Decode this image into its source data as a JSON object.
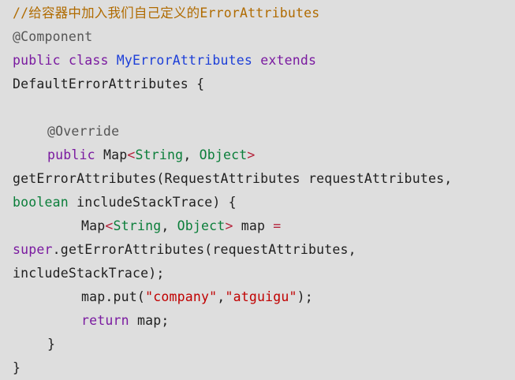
{
  "code": {
    "line1": {
      "comment_prefix": "//给容器中加入我们自己定义的",
      "comment_suffix": "ErrorAttributes"
    },
    "line2": {
      "annotation": "@Component"
    },
    "line3": {
      "kw_public": "public",
      "kw_class": "class",
      "class_name": "MyErrorAttributes",
      "kw_extends": "extends"
    },
    "line4": {
      "text": "DefaultErrorAttributes {"
    },
    "line5": {
      "text": ""
    },
    "line6": {
      "annotation": "@Override"
    },
    "line7": {
      "kw_public": "public",
      "type_map": "Map",
      "lt": "<",
      "type_string": "String",
      "comma": ", ",
      "type_object": "Object",
      "gt": ">"
    },
    "line8": {
      "text": "getErrorAttributes(RequestAttributes requestAttributes,"
    },
    "line9": {
      "kw_boolean": "boolean",
      "rest": " includeStackTrace) {"
    },
    "line10": {
      "type_map": "Map",
      "lt": "<",
      "type_string": "String",
      "comma": ", ",
      "type_object": "Object",
      "gt": ">",
      "var": " map ",
      "eq": "="
    },
    "line11": {
      "kw_super": "super",
      "rest": ".getErrorAttributes(requestAttributes,"
    },
    "line12": {
      "text": "includeStackTrace);"
    },
    "line13": {
      "prefix": "map.put(",
      "str1": "\"company\"",
      "comma": ",",
      "str2": "\"atguigu\"",
      "suffix": ");"
    },
    "line14": {
      "kw_return": "return",
      "rest": " map;"
    },
    "line15": {
      "text": "}"
    },
    "line16": {
      "text": "}"
    }
  }
}
